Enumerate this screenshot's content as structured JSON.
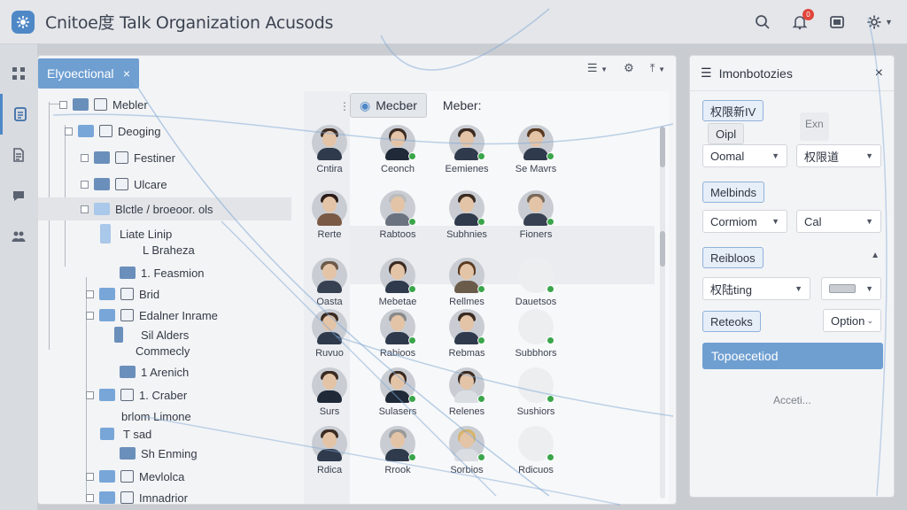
{
  "app": {
    "title": "Cnitoe度 Talk Organization Acusods",
    "notification_count": "0"
  },
  "rail": {
    "items": [
      "grid-icon",
      "org-icon",
      "document-icon",
      "chat-icon",
      "people-icon"
    ]
  },
  "main": {
    "tab_label": "Elyoectional",
    "tab_close": "×",
    "tree": [
      {
        "label": "Mebler",
        "icon": "file"
      },
      {
        "label": "Deoging",
        "icon": "file"
      },
      {
        "label": "Festiner",
        "icon": "file"
      },
      {
        "label": "Ulcare",
        "icon": "file"
      },
      {
        "label": "Blctle / broeoor. ols",
        "icon": "folder"
      },
      {
        "label": "Liate Linip",
        "icon": "folder"
      },
      {
        "label": "L Braheza",
        "icon": "none"
      },
      {
        "label": "1. Feasmion",
        "icon": "none"
      },
      {
        "label": "Brid",
        "icon": "file"
      },
      {
        "label": "Edalner Inrame",
        "icon": "file"
      },
      {
        "label": "Sil Alders",
        "icon": "none"
      },
      {
        "label": "Commecly",
        "icon": "none"
      },
      {
        "label": "1 Arenich",
        "icon": "none"
      },
      {
        "label": "1. Craber",
        "icon": "file"
      },
      {
        "label": "brlom Limone",
        "icon": "none"
      },
      {
        "label": "T sad",
        "icon": "none"
      },
      {
        "label": "Sh Enming",
        "icon": "none"
      },
      {
        "label": "Mevlolca",
        "icon": "file"
      },
      {
        "label": "Imnadrior",
        "icon": "file"
      }
    ],
    "grid_tabs": [
      "Mecber",
      "Meber:"
    ],
    "people_row1": [
      "Cntira",
      "Ceonch",
      "Eemienes",
      "Se Mavrs"
    ],
    "people_row2": [
      "Rerte",
      "Rabtoos",
      "Subhnies",
      "Fioners"
    ],
    "people_row3": [
      "Oasta",
      "Mebetae",
      "Rellmes",
      "Dauetsos"
    ],
    "people_row4": [
      "Ruvuo",
      "Rabioos",
      "Rebmas",
      "Subbhors"
    ],
    "people_row5": [
      "Surs",
      "Sulasers",
      "Relenes",
      "Sushiors"
    ],
    "people_row6": [
      "Rdica",
      "Rrook",
      "Sorbios",
      "Rdicuos"
    ]
  },
  "panel": {
    "title": "Imonbotozies",
    "close": "×",
    "tag1": "权限新IV",
    "tag1_sub": "Oipl",
    "muted1": "Exn",
    "select1": "Oomal",
    "select2": "权限道",
    "tag2": "Melbinds",
    "select3": "Cormiom",
    "select4": "Cal",
    "tag3": "Reibloos",
    "select5": "权陆ting",
    "tag4": "Reteoks",
    "option_label": "Option",
    "primary_button": "Topoecetiod",
    "footer_text": "Acceti..."
  }
}
